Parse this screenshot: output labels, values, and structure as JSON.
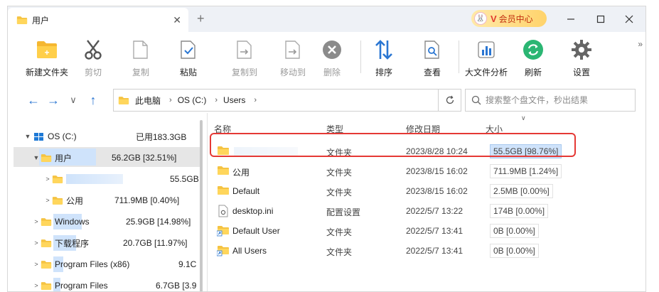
{
  "tab": {
    "title": "用户"
  },
  "vip": {
    "label": "会员中心"
  },
  "toolbar": {
    "items": [
      {
        "label": "新建文件夹",
        "icon": "new-folder-icon"
      },
      {
        "label": "剪切",
        "icon": "scissors-icon"
      },
      {
        "label": "复制",
        "icon": "copy-icon"
      },
      {
        "label": "粘贴",
        "icon": "paste-icon"
      },
      {
        "label": "复制到",
        "icon": "copy-to-icon"
      },
      {
        "label": "移动到",
        "icon": "move-to-icon"
      },
      {
        "label": "删除",
        "icon": "delete-icon"
      },
      {
        "label": "排序",
        "icon": "sort-icon"
      },
      {
        "label": "查看",
        "icon": "view-icon"
      },
      {
        "label": "大文件分析",
        "icon": "chart-icon"
      },
      {
        "label": "刷新",
        "icon": "refresh-icon"
      },
      {
        "label": "设置",
        "icon": "gear-icon"
      }
    ],
    "more": "»"
  },
  "address": {
    "crumbs": [
      "此电脑",
      "OS (C:)",
      "Users"
    ]
  },
  "search": {
    "placeholder": "搜索整个盘文件，秒出结果"
  },
  "tree": {
    "rows": [
      {
        "name": "OS (C:)",
        "size": "已用183.3GB"
      },
      {
        "name": "用户",
        "size": "56.2GB [32.51%]"
      },
      {
        "name": "",
        "size": "55.5GB"
      },
      {
        "name": "公用",
        "size": "711.9MB [0.40%]"
      },
      {
        "name": "Windows",
        "size": "25.9GB [14.98%]"
      },
      {
        "name": "下载程序",
        "size": "20.7GB [11.97%]"
      },
      {
        "name": "Program Files (x86)",
        "size": "9.1C"
      },
      {
        "name": "Program Files",
        "size": "6.7GB [3.9"
      }
    ],
    "bars": [
      0.3251,
      0.01,
      0.004,
      0.1498,
      0.1197,
      0.053,
      0.039
    ]
  },
  "list": {
    "headers": {
      "name": "名称",
      "type": "类型",
      "date": "修改日期",
      "size": "大小"
    },
    "rows": [
      {
        "name": "",
        "type": "文件夹",
        "date": "2023/8/28 10:24",
        "size": "55.5GB [98.76%]",
        "fraction": 0.9876,
        "icon": "folder-icon"
      },
      {
        "name": "公用",
        "type": "文件夹",
        "date": "2023/8/15 16:02",
        "size": "711.9MB [1.24%]",
        "fraction": 0.0124,
        "icon": "folder-icon"
      },
      {
        "name": "Default",
        "type": "文件夹",
        "date": "2023/8/15 16:02",
        "size": "2.5MB [0.00%]",
        "fraction": 0.0,
        "icon": "folder-icon"
      },
      {
        "name": "desktop.ini",
        "type": "配置设置",
        "date": "2022/5/7 13:22",
        "size": "174B [0.00%]",
        "fraction": 0.0,
        "icon": "settings-file-icon"
      },
      {
        "name": "Default User",
        "type": "文件夹",
        "date": "2022/5/7 13:41",
        "size": "0B [0.00%]",
        "fraction": 0.0,
        "icon": "shortcut-folder-icon"
      },
      {
        "name": "All Users",
        "type": "文件夹",
        "date": "2022/5/7 13:41",
        "size": "0B [0.00%]",
        "fraction": 0.0,
        "icon": "shortcut-folder-icon"
      }
    ]
  },
  "colors": {
    "accent": "#2a76d2",
    "folder": "#f5c342",
    "highlight": "#e53935",
    "bar": "#cfe3fb"
  }
}
